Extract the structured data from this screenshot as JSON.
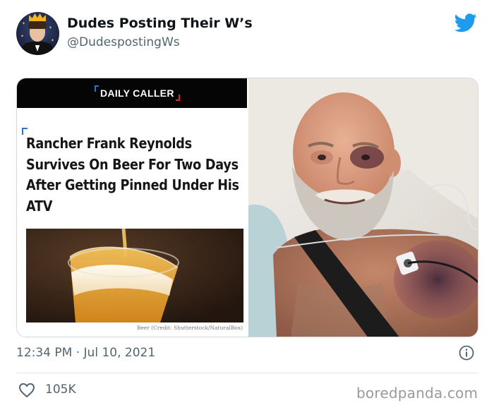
{
  "tweet": {
    "author": {
      "display_name": "Dudes Posting Their W’s",
      "handle": "@DudespostingWs",
      "avatar_icon": "crowned-man-avatar"
    },
    "brand_icon": "twitter-bird-icon",
    "brand_color": "#1d9bf0",
    "timestamp": "12:34 PM · Jul 10, 2021",
    "likes": "105K"
  },
  "article_card": {
    "publication": "DAILY CALLER",
    "headline": "Rancher Frank Reynolds Survives On Beer For Two Days After Getting Pinned Under His ATV",
    "image_caption": "Beer (Credit: Shutterstock/NaturalBox)"
  },
  "watermark": "boredpanda.com"
}
